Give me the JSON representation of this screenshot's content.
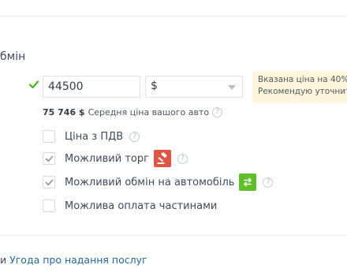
{
  "section": {
    "title": "бмін"
  },
  "price": {
    "value": "44500"
  },
  "currency": {
    "selected": "$"
  },
  "hint": {
    "line1": "Вказана ціна на 40% н",
    "line2": "Рекомендую уточнит"
  },
  "average": {
    "value": "75 746 $",
    "label": "Середня ціна вашого авто"
  },
  "options": [
    {
      "label": "Ціна з ПДВ",
      "checked": false
    },
    {
      "label": "Можливий торг",
      "checked": true,
      "icon": "auction-hammer-icon"
    },
    {
      "label": "Можливий обмін на автомобіль",
      "checked": true,
      "icon": "car-exchange-icon"
    },
    {
      "label": "Можлива оплата частинами",
      "checked": false
    }
  ],
  "footer": {
    "prefix": "и",
    "link": "Угода про надання послуг"
  },
  "colors": {
    "accent_link": "#256799",
    "check_green": "#4caf1f",
    "badge_red": "#e05443",
    "badge_green": "#5fbf2a",
    "hint_bg": "#fdf6dd"
  }
}
